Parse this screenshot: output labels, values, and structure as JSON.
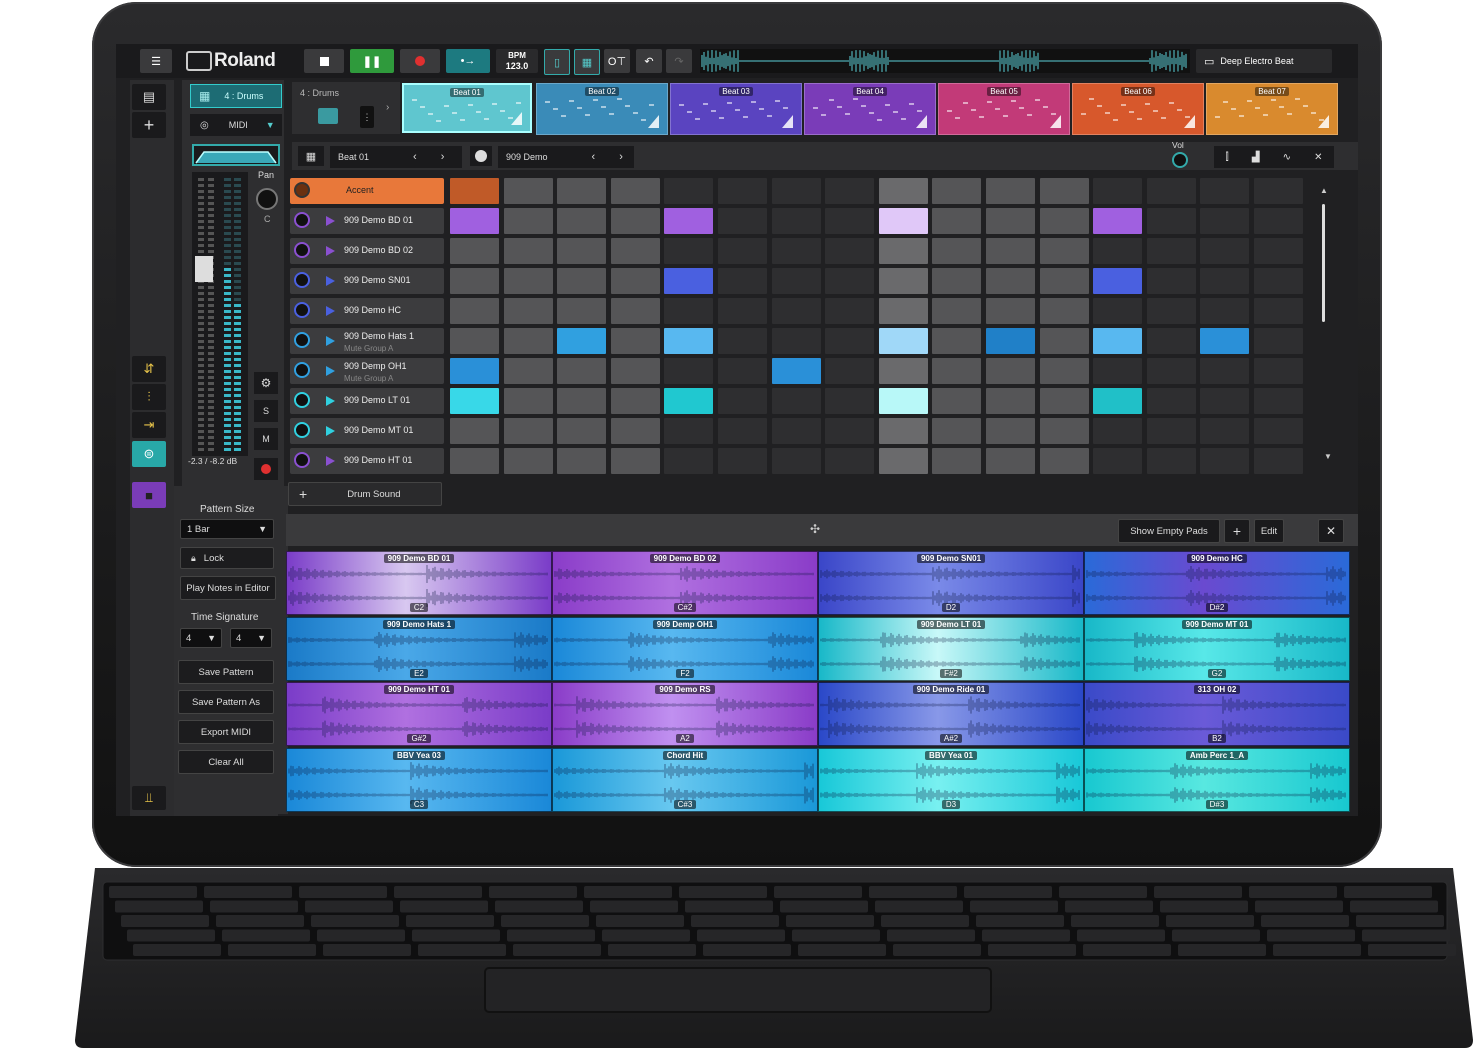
{
  "header": {
    "brand": "Roland",
    "bpm_label": "BPM",
    "bpm_value": "123.0",
    "project_name": "Deep Electro Beat"
  },
  "track": {
    "name": "4 : Drums",
    "input": "MIDI",
    "pan_label": "Pan",
    "pan_value": "C",
    "level_readout": "-2.3 / -8.2 dB",
    "solo_label": "S",
    "mute_label": "M"
  },
  "patterns": {
    "track_label": "4 : Drums",
    "slots": [
      {
        "name": "Beat 01",
        "color": "#5fc6cf",
        "selected": true
      },
      {
        "name": "Beat 02",
        "color": "#3a8bb8"
      },
      {
        "name": "Beat 03",
        "color": "#5a44c0"
      },
      {
        "name": "Beat 04",
        "color": "#7a3cb8"
      },
      {
        "name": "Beat 05",
        "color": "#c23a78"
      },
      {
        "name": "Beat 06",
        "color": "#d7582c"
      },
      {
        "name": "Beat 07",
        "color": "#d98a2e"
      }
    ]
  },
  "editor": {
    "pattern_name": "Beat 01",
    "kit_name": "909 Demo",
    "vol_label": "Vol"
  },
  "rows": [
    {
      "label": "Accent",
      "sub": ""
    },
    {
      "label": "909 Demo BD 01",
      "sub": ""
    },
    {
      "label": "909 Demo BD 02",
      "sub": ""
    },
    {
      "label": "909 Demo SN01",
      "sub": ""
    },
    {
      "label": "909 Demo HC",
      "sub": ""
    },
    {
      "label": "909 Demo Hats 1",
      "sub": "Mute Group A"
    },
    {
      "label": "909 Demp OH1",
      "sub": "Mute Group A"
    },
    {
      "label": "909 Demo LT 01",
      "sub": ""
    },
    {
      "label": "909 Demo MT 01",
      "sub": ""
    },
    {
      "label": "909 Demo HT 01",
      "sub": ""
    }
  ],
  "add_drum_sound": "Drum Sound",
  "left_panel": {
    "pattern_size_label": "Pattern Size",
    "pattern_size_value": "1 Bar",
    "lock_label": "Lock",
    "play_notes_label": "Play Notes in Editor",
    "time_signature_label": "Time Signature",
    "ts_numerator": "4",
    "ts_denominator": "4",
    "save_pattern": "Save Pattern",
    "save_pattern_as": "Save Pattern As",
    "export_midi": "Export MIDI",
    "clear_all": "Clear All"
  },
  "pad_bar": {
    "show_empty_pads": "Show Empty Pads",
    "edit": "Edit"
  },
  "pads": [
    {
      "name": "909 Demo BD 01",
      "note": "C2",
      "c1": "#7a3cc8",
      "c2": "#d8c8f0"
    },
    {
      "name": "909 Demo BD 02",
      "note": "C#2",
      "c1": "#8a3cc8",
      "c2": "#b070e0"
    },
    {
      "name": "909 Demo SN01",
      "note": "D2",
      "c1": "#3a46c8",
      "c2": "#7a8ae8"
    },
    {
      "name": "909 Demo HC",
      "note": "D#2",
      "c1": "#2a6ad8",
      "c2": "#6a4ad0"
    },
    {
      "name": "909 Demo Hats 1",
      "note": "E2",
      "c1": "#1a7ac8",
      "c2": "#4aa8e8"
    },
    {
      "name": "909 Demp OH1",
      "note": "F2",
      "c1": "#1a88d8",
      "c2": "#58b8f0"
    },
    {
      "name": "909 Demo LT 01",
      "note": "F#2",
      "c1": "#18b8c8",
      "c2": "#c8f8f8"
    },
    {
      "name": "909 Demo MT 01",
      "note": "G2",
      "c1": "#18b8c8",
      "c2": "#58e8e8"
    },
    {
      "name": "909 Demo HT 01",
      "note": "G#2",
      "c1": "#7a3cc8",
      "c2": "#b070e0"
    },
    {
      "name": "909 Demo RS",
      "note": "A2",
      "c1": "#8a3cc8",
      "c2": "#c090f0"
    },
    {
      "name": "909 Demo Ride 01",
      "note": "A#2",
      "c1": "#2a48c8",
      "c2": "#8898e8"
    },
    {
      "name": "313 OH 02",
      "note": "B2",
      "c1": "#3a4ac8",
      "c2": "#6a5ad8"
    },
    {
      "name": "BBV Yea 03",
      "note": "C3",
      "c1": "#1a88d8",
      "c2": "#58b8f0"
    },
    {
      "name": "Chord Hit",
      "note": "C#3",
      "c1": "#1a98d8",
      "c2": "#68c8f0"
    },
    {
      "name": "BBV Yea 01",
      "note": "D3",
      "c1": "#18c8d8",
      "c2": "#78f0f0"
    },
    {
      "name": "Amb Perc 1_A",
      "note": "D#3",
      "c1": "#18c8d0",
      "c2": "#58e8e0"
    }
  ],
  "colors": {
    "accent": "#e8783a",
    "purple": "#a060e0",
    "blue": "#4a60e0",
    "sky": "#30a0e0",
    "cyan": "#30d0e0",
    "record": "#e03030",
    "play": "#30a040"
  }
}
